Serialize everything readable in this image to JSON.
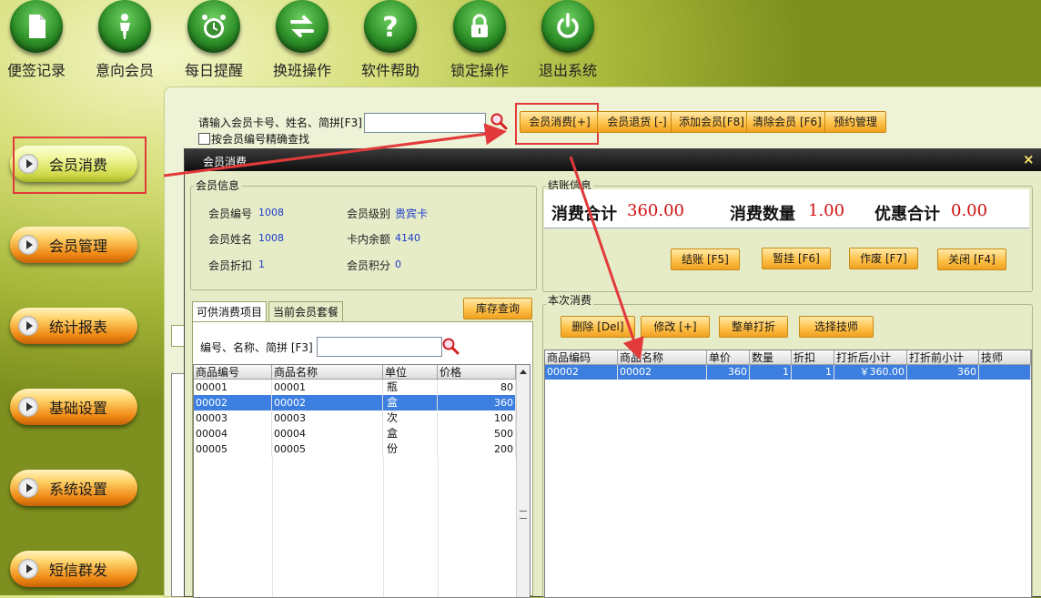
{
  "toolbar": {
    "items": [
      {
        "label": "便签记录",
        "icon": "note-icon"
      },
      {
        "label": "意向会员",
        "icon": "person-icon"
      },
      {
        "label": "每日提醒",
        "icon": "alarm-clock-icon"
      },
      {
        "label": "换班操作",
        "icon": "swap-arrows-icon"
      },
      {
        "label": "软件帮助",
        "icon": "question-icon"
      },
      {
        "label": "锁定操作",
        "icon": "lock-icon"
      },
      {
        "label": "退出系统",
        "icon": "power-icon"
      }
    ]
  },
  "sidebar": {
    "items": [
      {
        "label": "会员消费",
        "active": true
      },
      {
        "label": "会员管理"
      },
      {
        "label": "统计报表"
      },
      {
        "label": "基础设置"
      },
      {
        "label": "系统设置"
      },
      {
        "label": "短信群发"
      }
    ]
  },
  "search": {
    "label": "请输入会员卡号、姓名、简拼[F3]",
    "value": "",
    "exact_label": "按会员编号精确查找"
  },
  "actions": {
    "consume": "会员消费[+]",
    "return": "会员退货 [-]",
    "add_member": "添加会员[F8]",
    "clear_member": "清除会员 [F6]",
    "booking": "预约管理"
  },
  "dialog": {
    "title": "会员消费",
    "close": "×",
    "member": {
      "group_title": "会员信息",
      "no_label": "会员编号",
      "no": "1008",
      "level_label": "会员级别",
      "level": "贵宾卡",
      "name_label": "会员姓名",
      "name": "1008",
      "balance_label": "卡内余额",
      "balance": "4140",
      "discount_label": "会员折扣",
      "discount": "1",
      "points_label": "会员积分",
      "points": "0"
    },
    "settle": {
      "group_title": "结账信息",
      "total_label": "消费合计",
      "total": "360.00",
      "qty_label": "消费数量",
      "qty": "1.00",
      "discount_label": "优惠合计",
      "discount": "0.00",
      "btn_checkout": "结账 [F5]",
      "btn_hold": "暂挂 [F6]",
      "btn_void": "作废 [F7]",
      "btn_close": "关闭 [F4]"
    },
    "tabs": {
      "items": "可供消费项目",
      "packages": "当前会员套餐",
      "stock": "库存查询"
    },
    "product_search": {
      "label": "编号、名称、简拼 [F3]",
      "value": ""
    },
    "product_table": {
      "columns": [
        "商品编号",
        "商品名称",
        "单位",
        "价格"
      ],
      "rows": [
        {
          "code": "00001",
          "name": "00001",
          "unit": "瓶",
          "price": "80"
        },
        {
          "code": "00002",
          "name": "00002",
          "unit": "盒",
          "price": "360",
          "selected": true
        },
        {
          "code": "00003",
          "name": "00003",
          "unit": "次",
          "price": "100"
        },
        {
          "code": "00004",
          "name": "00004",
          "unit": "盒",
          "price": "500"
        },
        {
          "code": "00005",
          "name": "00005",
          "unit": "份",
          "price": "200"
        }
      ]
    },
    "current": {
      "group_title": "本次消费",
      "btn_delete": "删除 [Del]",
      "btn_edit": "修改 [+]",
      "btn_bill_discount": "整单打折",
      "btn_technician": "选择技师",
      "columns": [
        "商品编码",
        "商品名称",
        "单价",
        "数量",
        "折扣",
        "打折后小计",
        "打折前小计",
        "技师"
      ],
      "rows": [
        {
          "code": "00002",
          "name": "00002",
          "price": "360",
          "qty": "1",
          "discount": "1",
          "after": "￥360.00",
          "before": "360",
          "tech": ""
        }
      ]
    }
  },
  "colors": {
    "annotation": "#e23a3a",
    "selection": "#3c7fe0",
    "title_bar": "#111111",
    "amount_red": "#d01010"
  }
}
